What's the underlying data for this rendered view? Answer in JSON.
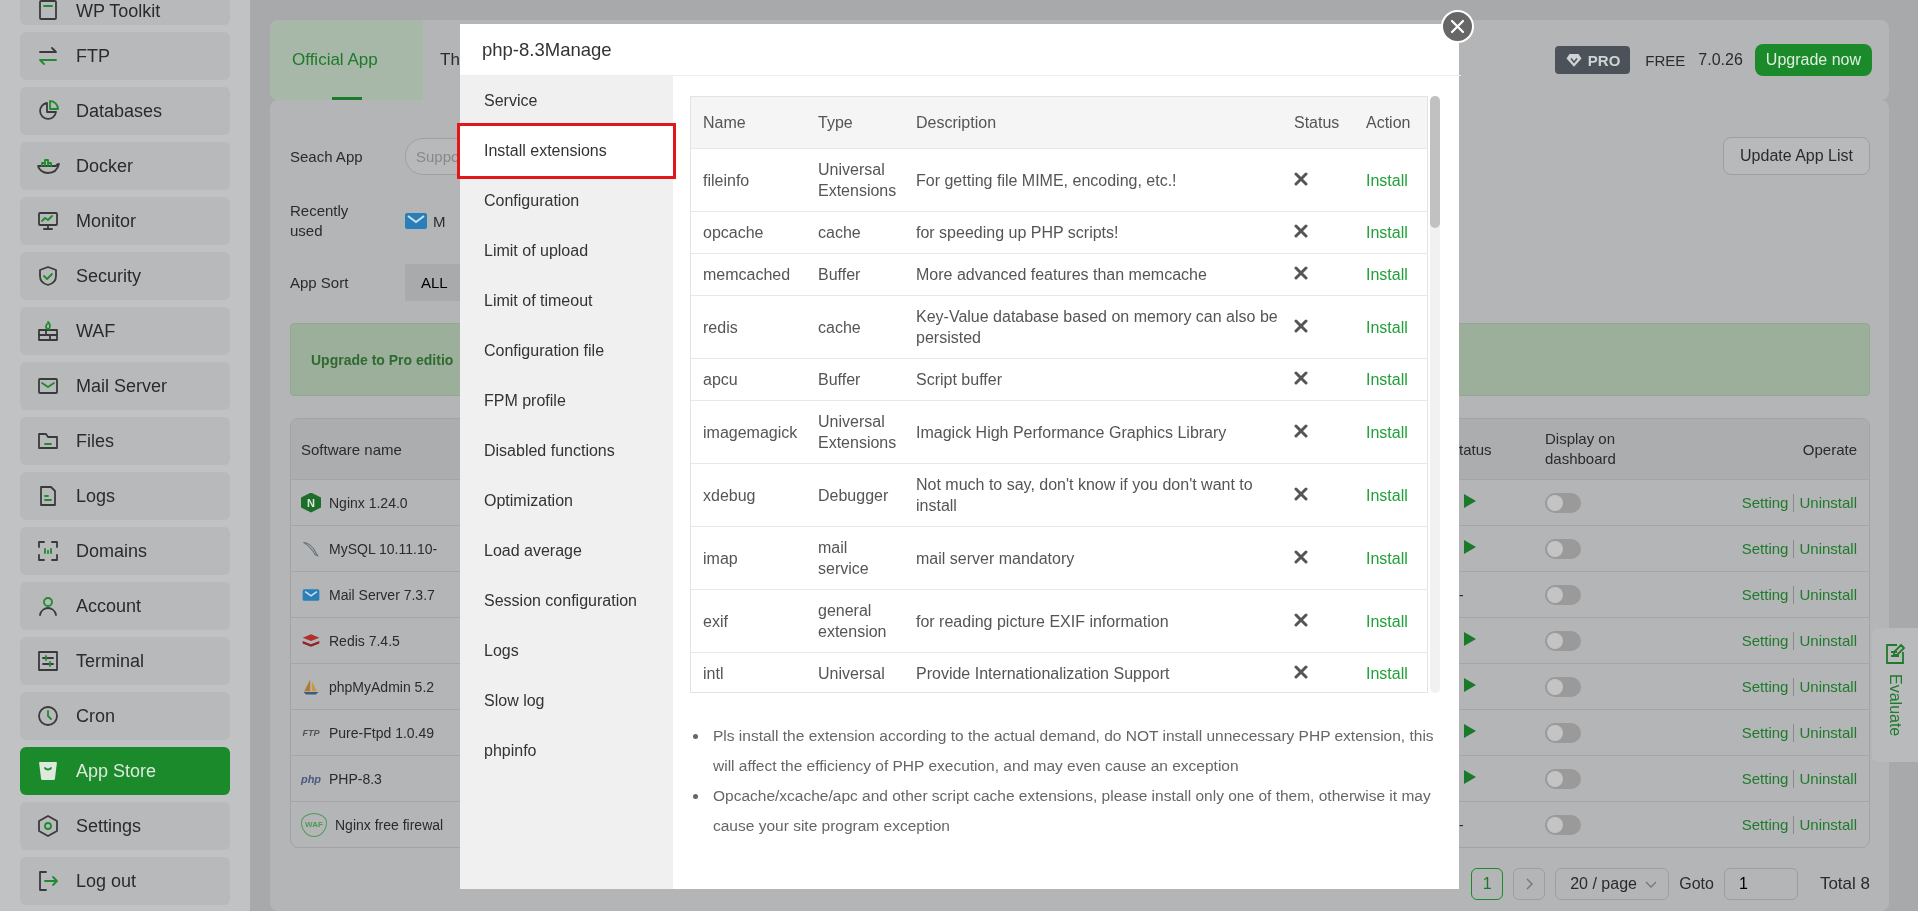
{
  "sidebar": {
    "items": [
      {
        "label": "WP Toolkit",
        "selected": false
      },
      {
        "label": "FTP",
        "selected": false
      },
      {
        "label": "Databases",
        "selected": false
      },
      {
        "label": "Docker",
        "selected": false
      },
      {
        "label": "Monitor",
        "selected": false
      },
      {
        "label": "Security",
        "selected": false
      },
      {
        "label": "WAF",
        "selected": false
      },
      {
        "label": "Mail Server",
        "selected": false
      },
      {
        "label": "Files",
        "selected": false
      },
      {
        "label": "Logs",
        "selected": false
      },
      {
        "label": "Domains",
        "selected": false
      },
      {
        "label": "Account",
        "selected": false
      },
      {
        "label": "Terminal",
        "selected": false
      },
      {
        "label": "Cron",
        "selected": false
      },
      {
        "label": "App Store",
        "selected": true
      },
      {
        "label": "Settings",
        "selected": false
      },
      {
        "label": "Log out",
        "selected": false
      }
    ]
  },
  "tabs": [
    {
      "label": "Official App",
      "selected": true
    },
    {
      "label": "Th",
      "selected": false
    }
  ],
  "edition": {
    "pro_badge": "PRO",
    "free_label": "FREE",
    "version": "7.0.26",
    "upgrade_button": "Upgrade now"
  },
  "search": {
    "label": "Seach App",
    "placeholder": "Suppo"
  },
  "update_button": "Update App List",
  "recently_used": {
    "label": "Recently used",
    "apps": [
      "M"
    ]
  },
  "app_sort": {
    "label": "App Sort",
    "options": [
      {
        "label": "ALL",
        "selected": true
      }
    ]
  },
  "banner": "Upgrade to Pro editio",
  "software_table": {
    "columns": [
      "Software name",
      "tatus",
      "Display on dashboard",
      "Operate"
    ],
    "rows": [
      {
        "name": "Nginx 1.24.0",
        "logo_text": "N",
        "running": true,
        "on": false,
        "actions": [
          "Setting",
          "Uninstall"
        ]
      },
      {
        "name": "MySQL 10.11.10-",
        "running": true,
        "on": false,
        "actions": [
          "Setting",
          "Uninstall"
        ]
      },
      {
        "name": "Mail Server 7.3.7",
        "running": false,
        "status": "-",
        "on": false,
        "actions": [
          "Setting",
          "Uninstall"
        ]
      },
      {
        "name": "Redis 7.4.5",
        "running": true,
        "on": false,
        "actions": [
          "Setting",
          "Uninstall"
        ]
      },
      {
        "name": "phpMyAdmin 5.2",
        "running": true,
        "on": false,
        "actions": [
          "Setting",
          "Uninstall"
        ]
      },
      {
        "name": "Pure-Ftpd 1.0.49",
        "logo_text": "FTP",
        "running": true,
        "on": false,
        "actions": [
          "Setting",
          "Uninstall"
        ]
      },
      {
        "name": "PHP-8.3",
        "logo_text": "php",
        "running": true,
        "on": false,
        "actions": [
          "Setting",
          "Uninstall"
        ]
      },
      {
        "name": "Nginx free firewal",
        "logo_text": "WAF",
        "running": false,
        "status": "-",
        "on": false,
        "actions": [
          "Setting",
          "Uninstall"
        ]
      }
    ]
  },
  "pagination": {
    "pages": [
      {
        "label": "1",
        "selected": true
      }
    ],
    "page_size": "20 / page",
    "goto_label": "Goto",
    "goto_value": "1",
    "total": "Total 8"
  },
  "evaluate": "Evaluate",
  "modal": {
    "title": "php-8.3Manage",
    "menu": [
      {
        "label": "Service",
        "selected": false
      },
      {
        "label": "Install extensions",
        "selected": true
      },
      {
        "label": "Configuration",
        "selected": false
      },
      {
        "label": "Limit of upload",
        "selected": false
      },
      {
        "label": "Limit of timeout",
        "selected": false
      },
      {
        "label": "Configuration file",
        "selected": false
      },
      {
        "label": "FPM profile",
        "selected": false
      },
      {
        "label": "Disabled functions",
        "selected": false
      },
      {
        "label": "Optimization",
        "selected": false
      },
      {
        "label": "Load average",
        "selected": false
      },
      {
        "label": "Session configuration",
        "selected": false
      },
      {
        "label": "Logs",
        "selected": false
      },
      {
        "label": "Slow log",
        "selected": false
      },
      {
        "label": "phpinfo",
        "selected": false
      }
    ],
    "extensions": {
      "columns": [
        "Name",
        "Type",
        "Description",
        "Status",
        "Action"
      ],
      "rows": [
        {
          "name": "fileinfo",
          "type": "Universal Extensions",
          "description": "For getting file MIME, encoding, etc.!",
          "installed": false,
          "action": "Install"
        },
        {
          "name": "opcache",
          "type": "cache",
          "description": "for speeding up PHP scripts!",
          "installed": false,
          "action": "Install"
        },
        {
          "name": "memcached",
          "type": "Buffer",
          "description": "More advanced features than memcache",
          "installed": false,
          "action": "Install"
        },
        {
          "name": "redis",
          "type": "cache",
          "description": "Key-Value database based on memory can also be persisted",
          "installed": false,
          "action": "Install"
        },
        {
          "name": "apcu",
          "type": "Buffer",
          "description": "Script buffer",
          "installed": false,
          "action": "Install"
        },
        {
          "name": "imagemagick",
          "type": "Universal Extensions",
          "description": "Imagick High Performance Graphics Library",
          "installed": false,
          "action": "Install"
        },
        {
          "name": "xdebug",
          "type": "Debugger",
          "description": "Not much to say, don't know if you don't want to install",
          "installed": false,
          "action": "Install"
        },
        {
          "name": "imap",
          "type": "mail service",
          "description": "mail server mandatory",
          "installed": false,
          "action": "Install"
        },
        {
          "name": "exif",
          "type": "general extension",
          "description": "for reading picture EXIF information",
          "installed": false,
          "action": "Install"
        },
        {
          "name": "intl",
          "type": "Universal",
          "description": "Provide Internationalization Support",
          "installed": false,
          "action": "Install"
        }
      ]
    },
    "notes": [
      "Pls install the extension according to the actual demand, do NOT install unnecessary PHP extension, this will affect the efficiency of PHP execution, and may even cause an exception",
      "Opcache/xcache/apc and other script cache extensions, please install only one of them, otherwise it may cause your site program exception"
    ]
  }
}
